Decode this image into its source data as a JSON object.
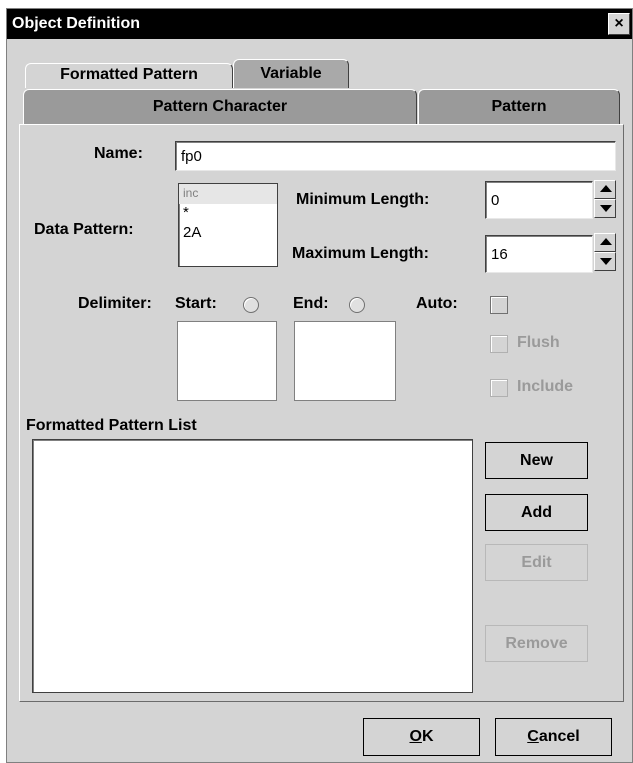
{
  "window": {
    "title": "Object Definition",
    "close_icon": "close-icon",
    "close_glyph": "×"
  },
  "tabs": {
    "row1": [
      {
        "label": "Formatted Pattern"
      },
      {
        "label": "Variable"
      }
    ],
    "row2": [
      {
        "label": "Pattern Character"
      },
      {
        "label": "Pattern"
      }
    ]
  },
  "form": {
    "name_label": "Name:",
    "name_value": "fp0",
    "data_pattern_label": "Data Pattern:",
    "data_pattern_items": [
      "inc",
      "*",
      "2A"
    ],
    "min_length_label": "Minimum Length:",
    "min_length_value": "0",
    "max_length_label": "Maximum Length:",
    "max_length_value": "16",
    "delimiter_label": "Delimiter:",
    "start_label": "Start:",
    "end_label": "End:",
    "auto_label": "Auto:",
    "flush_label": "Flush",
    "include_label": "Include"
  },
  "list": {
    "title": "Formatted Pattern List",
    "items": []
  },
  "buttons": {
    "new": "New",
    "add": "Add",
    "edit": "Edit",
    "remove": "Remove",
    "ok_mnemonic": "O",
    "ok_rest": "K",
    "cancel_mnemonic": "C",
    "cancel_rest": "ancel"
  }
}
